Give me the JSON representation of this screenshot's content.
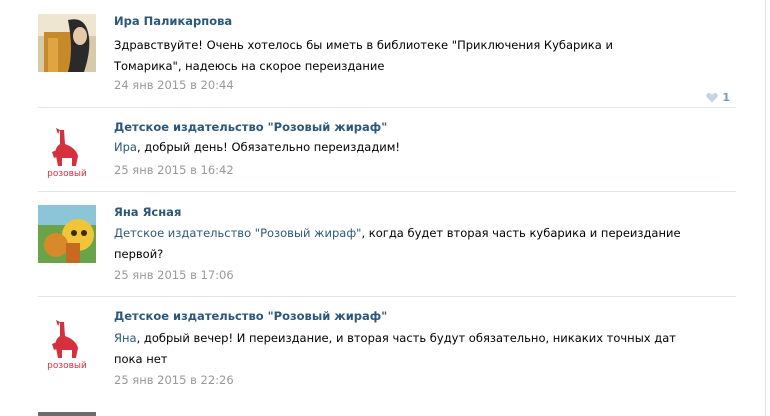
{
  "comments": [
    {
      "author": "Ира Паликарпова",
      "text_plain": "Здравствуйте! Очень хотелось бы иметь в библиотеке \"Приключения Кубарика и Томарика\", надеюсь на скорое переиздание",
      "date": "24 янв 2015 в 20:44",
      "likes": "1",
      "avatar_icon": "person-photo"
    },
    {
      "author": "Детское издательство \"Розовый жираф\"",
      "mention": "Ира",
      "text_rest": ", добрый день! Обязательно переиздадим!",
      "date": "25 янв 2015 в 16:42",
      "avatar_icon": "pink-giraffe-logo",
      "avatar_logo_text": "розовый"
    },
    {
      "author": "Яна Ясная",
      "mention": "Детское издательство \"Розовый жираф\"",
      "text_rest": ", когда будет вторая часть кубарика и переиздание первой?",
      "date": "25 янв 2015 в 17:06",
      "avatar_icon": "painted-picture"
    },
    {
      "author": "Детское издательство \"Розовый жираф\"",
      "mention": "Яна",
      "text_rest": ", добрый вечер! И переиздание, и вторая часть будут обязательно, никаких точных дат пока нет",
      "date": "25 янв 2015 в 22:26",
      "avatar_icon": "pink-giraffe-logo",
      "avatar_logo_text": "розовый"
    }
  ],
  "colors": {
    "link": "#2b587a",
    "meta": "#999999",
    "separator": "#dfe4ea",
    "logo": "#d6303f"
  }
}
